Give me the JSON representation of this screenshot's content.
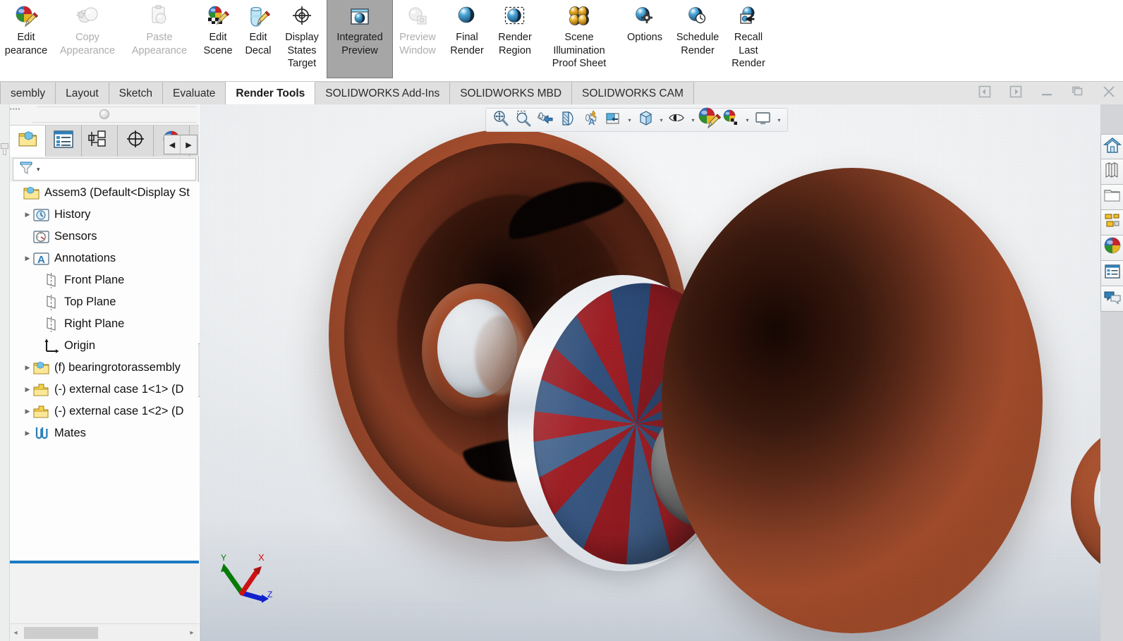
{
  "app": {
    "title": "SOLIDWORKS"
  },
  "ribbon": {
    "buttons": [
      {
        "id": "edit-appearance",
        "label": "Edit\npearance",
        "icon": "sphere-pencil-icon",
        "enabled": true,
        "active": false
      },
      {
        "id": "copy-appearance",
        "label": "Copy\nAppearance",
        "icon": "two-spheres-copy-icon",
        "enabled": false,
        "active": false
      },
      {
        "id": "paste-appearance",
        "label": "Paste\nAppearance",
        "icon": "clipboard-sphere-icon",
        "enabled": false,
        "active": false
      },
      {
        "id": "edit-scene",
        "label": "Edit\nScene",
        "icon": "checker-sphere-pencil-icon",
        "enabled": true,
        "active": false
      },
      {
        "id": "edit-decal",
        "label": "Edit\nDecal",
        "icon": "decal-pencil-icon",
        "enabled": true,
        "active": false
      },
      {
        "id": "display-states-target",
        "label": "Display\nStates\nTarget",
        "icon": "crosshair-target-icon",
        "enabled": true,
        "active": false
      },
      {
        "id": "integrated-preview",
        "label": "Integrated\nPreview",
        "icon": "window-sphere-icon",
        "enabled": true,
        "active": true
      },
      {
        "id": "preview-window",
        "label": "Preview\nWindow",
        "icon": "grey-sphere-window-icon",
        "enabled": false,
        "active": false
      },
      {
        "id": "final-render",
        "label": "Final\nRender",
        "icon": "blue-sphere-icon",
        "enabled": true,
        "active": false
      },
      {
        "id": "render-region",
        "label": "Render\nRegion",
        "icon": "dashed-box-sphere-icon",
        "enabled": true,
        "active": false
      },
      {
        "id": "scene-illumination-proof-sheet",
        "label": "Scene\nIllumination\nProof Sheet",
        "icon": "four-gold-spheres-icon",
        "enabled": true,
        "active": false
      },
      {
        "id": "options",
        "label": "Options",
        "icon": "sphere-gear-icon",
        "enabled": true,
        "active": false
      },
      {
        "id": "schedule-render",
        "label": "Schedule\nRender",
        "icon": "sphere-clock-icon",
        "enabled": true,
        "active": false
      },
      {
        "id": "recall-last-render",
        "label": "Recall\nLast\nRender",
        "icon": "sphere-recall-arrow-icon",
        "enabled": true,
        "active": false
      }
    ]
  },
  "tabs": {
    "items": [
      {
        "label": "sembly",
        "selected": false
      },
      {
        "label": "Layout",
        "selected": false
      },
      {
        "label": "Sketch",
        "selected": false
      },
      {
        "label": "Evaluate",
        "selected": false
      },
      {
        "label": "Render Tools",
        "selected": true
      },
      {
        "label": "SOLIDWORKS Add-Ins",
        "selected": false
      },
      {
        "label": "SOLIDWORKS MBD",
        "selected": false
      },
      {
        "label": "SOLIDWORKS CAM",
        "selected": false
      }
    ]
  },
  "window_controls": [
    {
      "id": "prev-doc",
      "icon": "panel-left-icon"
    },
    {
      "id": "next-doc",
      "icon": "panel-right-icon"
    },
    {
      "id": "minimize",
      "icon": "minimize-icon"
    },
    {
      "id": "restore",
      "icon": "restore-icon"
    },
    {
      "id": "close",
      "icon": "close-icon"
    }
  ],
  "left_panel": {
    "tabs": [
      {
        "id": "feature-manager",
        "icon": "feature-tree-icon",
        "selected": true
      },
      {
        "id": "property-manager",
        "icon": "property-list-icon",
        "selected": false
      },
      {
        "id": "configuration-manager",
        "icon": "configuration-icon",
        "selected": false
      },
      {
        "id": "dimxpert-manager",
        "icon": "dimxpert-target-icon",
        "selected": false
      },
      {
        "id": "appearances-manager",
        "icon": "appearance-sphere-icon",
        "selected": false
      }
    ],
    "tab_nav": {
      "prev": "◀",
      "next": "▶"
    },
    "filter": {
      "icon": "filter-funnel-icon",
      "caret": "▾",
      "placeholder": ""
    },
    "tree": [
      {
        "label": "Assem3  (Default<Display St",
        "icon": "assembly-icon",
        "indent": 0,
        "arrow": false,
        "bold": false
      },
      {
        "label": "History",
        "icon": "history-icon",
        "indent": 1,
        "arrow": true,
        "bold": false
      },
      {
        "label": "Sensors",
        "icon": "sensors-icon",
        "indent": 1,
        "arrow": false,
        "bold": false
      },
      {
        "label": "Annotations",
        "icon": "annotations-icon",
        "indent": 1,
        "arrow": true,
        "bold": false
      },
      {
        "label": "Front Plane",
        "icon": "plane-icon",
        "indent": 2,
        "arrow": false,
        "bold": false
      },
      {
        "label": "Top Plane",
        "icon": "plane-icon",
        "indent": 2,
        "arrow": false,
        "bold": false
      },
      {
        "label": "Right Plane",
        "icon": "plane-icon",
        "indent": 2,
        "arrow": false,
        "bold": false
      },
      {
        "label": "Origin",
        "icon": "origin-icon",
        "indent": 2,
        "arrow": false,
        "bold": false
      },
      {
        "label": "(f) bearingrotorassembly",
        "icon": "subassembly-icon",
        "indent": 1,
        "arrow": true,
        "bold": false
      },
      {
        "label": "(-) external case 1<1> (D",
        "icon": "part-icon",
        "indent": 1,
        "arrow": true,
        "bold": false
      },
      {
        "label": "(-) external case 1<2> (D",
        "icon": "part-icon",
        "indent": 1,
        "arrow": true,
        "bold": false
      },
      {
        "label": "Mates",
        "icon": "mates-icon",
        "indent": 1,
        "arrow": true,
        "bold": false
      }
    ],
    "hscroll": {
      "left_arrow": "◂",
      "right_arrow": "▸"
    }
  },
  "viewport": {
    "hud": [
      {
        "id": "zoom-to-fit",
        "icon": "zoom-fit-icon",
        "caret": false
      },
      {
        "id": "zoom-to-area",
        "icon": "zoom-area-icon",
        "caret": false
      },
      {
        "id": "previous-view",
        "icon": "previous-view-icon",
        "caret": false
      },
      {
        "id": "section-view",
        "icon": "section-view-icon",
        "caret": false
      },
      {
        "id": "view-orientation",
        "icon": "view-orientation-icon",
        "caret": false
      },
      {
        "id": "display-style",
        "icon": "display-style-icon",
        "caret": true
      },
      {
        "id": "hide-show-items",
        "icon": "hide-show-cube-icon",
        "caret": true
      },
      {
        "id": "view-settings",
        "icon": "eye-settings-icon",
        "caret": true
      },
      {
        "id": "apply-scene",
        "icon": "sphere-pencil-icon",
        "caret": false
      },
      {
        "id": "scene-backgrounds",
        "icon": "checker-sphere-icon",
        "caret": true
      },
      {
        "id": "view-setting-screen",
        "icon": "monitor-icon",
        "caret": true
      }
    ],
    "triad": {
      "x_label": "X",
      "x_color": "#cc1111",
      "y_label": "Y",
      "y_color": "#067a06",
      "z_label": "Z",
      "z_color": "#1020cc"
    },
    "model": {
      "name": "bearing rotor assembly render",
      "colors": {
        "case_copper": "#a34d2d",
        "case_dark": "#2a1009",
        "spacer_white": "#ffffff",
        "rotor_red": "#a02026",
        "rotor_blue": "#33537f",
        "hub_steel": "#8d9091",
        "bore_black": "#1d1d1d",
        "background": "#eef1f4"
      }
    }
  },
  "task_pane": [
    {
      "id": "solidworks-resources",
      "icon": "home-icon"
    },
    {
      "id": "design-library",
      "icon": "books-icon"
    },
    {
      "id": "file-explorer",
      "icon": "folder-icon"
    },
    {
      "id": "view-palette",
      "icon": "view-palette-icon"
    },
    {
      "id": "appearances-scenes",
      "icon": "appearance-sphere-icon"
    },
    {
      "id": "custom-properties",
      "icon": "properties-list-icon"
    },
    {
      "id": "solidworks-forum",
      "icon": "speech-bubbles-icon"
    }
  ]
}
